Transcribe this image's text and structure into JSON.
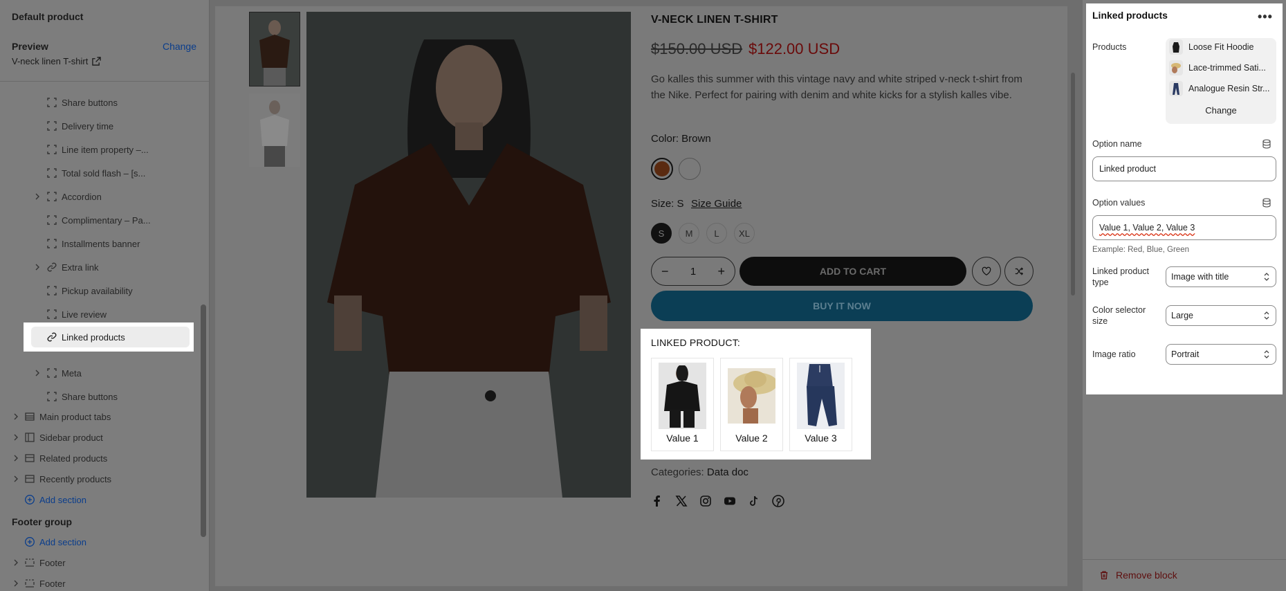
{
  "sidebar": {
    "title": "Default product",
    "preview_label": "Preview",
    "change_label": "Change",
    "preview_product": "V-neck linen T-shirt",
    "blocks": [
      {
        "label": "Share buttons",
        "icon": "block-icon",
        "hidden": true
      },
      {
        "label": "Delivery time",
        "icon": "block-icon",
        "hidden": true
      },
      {
        "label": "Line item property –...",
        "icon": "block-icon",
        "hidden": true
      },
      {
        "label": "Total sold flash – [s...",
        "icon": "block-icon",
        "hidden": true
      },
      {
        "label": "Accordion",
        "icon": "block-icon",
        "hidden": true,
        "expandable": true
      },
      {
        "label": "Complimentary – Pa...",
        "icon": "block-icon",
        "hidden": true
      },
      {
        "label": "Installments banner",
        "icon": "block-icon",
        "hidden": true
      },
      {
        "label": "Extra link",
        "icon": "link-icon",
        "hidden": true,
        "expandable": true
      },
      {
        "label": "Pickup availability",
        "icon": "block-icon",
        "hidden": true
      },
      {
        "label": "Live review",
        "icon": "block-icon",
        "hidden": true
      }
    ],
    "selected_block": "Linked products",
    "after_blocks": [
      {
        "label": "Meta",
        "expandable": true
      },
      {
        "label": "Share buttons"
      }
    ],
    "sections": [
      {
        "label": "Main product tabs",
        "hidden": false
      },
      {
        "label": "Sidebar product",
        "hidden": true
      },
      {
        "label": "Related products",
        "hidden": false
      },
      {
        "label": "Recently products",
        "hidden": false
      }
    ],
    "add_section": "Add section",
    "footer_group_title": "Footer group",
    "footer_add_section": "Add section",
    "footer_sections": [
      "Footer",
      "Footer"
    ]
  },
  "product": {
    "title": "V-NECK LINEN T-SHIRT",
    "old_price": "$150.00 USD",
    "new_price": "$122.00 USD",
    "description": "Go kalles this summer with this vintage navy and white striped v-neck t-shirt from the Nike. Perfect for pairing with denim and white kicks for a stylish kalles vibe.",
    "color_label": "Color: Brown",
    "colors": [
      "#5a2a10",
      "#8a8a8a"
    ],
    "size_label": "Size: S",
    "size_guide": "Size Guide",
    "sizes": [
      "S",
      "M",
      "L",
      "XL"
    ],
    "qty": "1",
    "qty_minus": "−",
    "qty_plus": "+",
    "add_to_cart": "ADD TO CART",
    "buy_now": "BUY IT NOW",
    "linked_title": "LINKED PRODUCT:",
    "linked_values": [
      "Value 1",
      "Value 2",
      "Value 3"
    ],
    "categories_label": "Categories:",
    "categories_value": "Data doc",
    "social_icons": [
      "facebook-icon",
      "x-icon",
      "instagram-icon",
      "youtube-icon",
      "tiktok-icon",
      "pinterest-icon"
    ]
  },
  "panel": {
    "title": "Linked products",
    "menu": "•••",
    "products_label": "Products",
    "products": [
      "Loose Fit Hoodie",
      "Lace-trimmed Sati...",
      "Analogue Resin Str..."
    ],
    "products_change": "Change",
    "option_name_label": "Option name",
    "option_name_value": "Linked product",
    "option_values_label": "Option values",
    "option_values_value": "Value 1, Value 2, Value 3",
    "option_values_hint": "Example: Red, Blue, Green",
    "linked_type_label_1": "Linked product",
    "linked_type_label_2": "type",
    "linked_type_value": "Image with title",
    "color_size_label_1": "Color selector",
    "color_size_label_2": "size",
    "color_size_value": "Large",
    "image_ratio_label": "Image ratio",
    "image_ratio_value": "Portrait",
    "remove_block": "Remove block"
  }
}
